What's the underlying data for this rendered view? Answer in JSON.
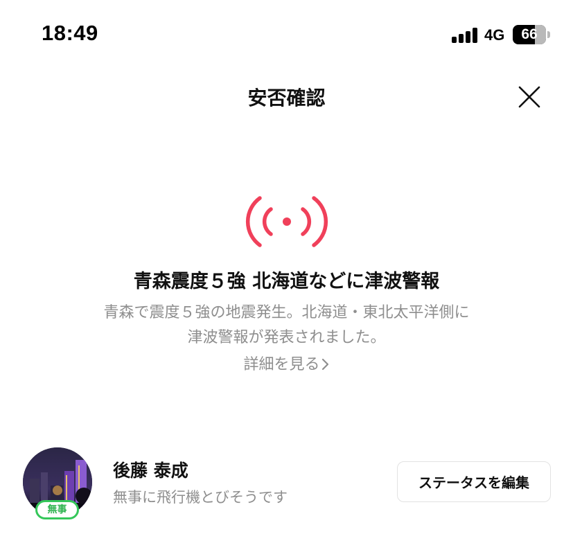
{
  "status_bar": {
    "time": "18:49",
    "network": "4G",
    "battery_level": "66",
    "icons": [
      "cellular-signal-icon",
      "battery-icon"
    ]
  },
  "header": {
    "title": "安否確認",
    "close_icon": "close-icon"
  },
  "alert": {
    "icon": "broadcast-signal-icon",
    "icon_color": "#f0405a",
    "title": "青森震度５強 北海道などに津波警報",
    "description_line1": "青森で震度５強の地震発生。北海道・東北太平洋側に",
    "description_line2": "津波警報が発表されました。",
    "details_link": "詳細を見る",
    "details_icon": "chevron-right-icon"
  },
  "user": {
    "name": "後藤 泰成",
    "status_message": "無事に飛行機とびそうです",
    "status_badge": "無事",
    "badge_color": "#35c75a",
    "edit_button": "ステータスを編集"
  }
}
